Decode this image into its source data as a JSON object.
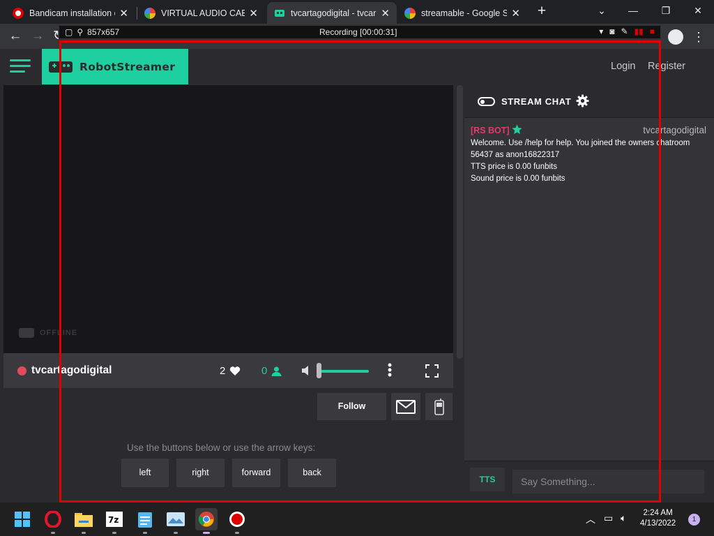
{
  "browser": {
    "tabs": [
      {
        "title": "Bandicam installation c",
        "favicon": "bandicam-icon"
      },
      {
        "title": "VIRTUAL AUDIO CABLE",
        "favicon": "google-icon"
      },
      {
        "title": "tvcartagodigital - tvcar",
        "favicon": "robotstreamer-icon"
      },
      {
        "title": "streamable - Google Se",
        "favicon": "google-icon"
      }
    ],
    "active_tab": 2,
    "new_tab_label": "+"
  },
  "recorder": {
    "size": "857x657",
    "status": "Recording [00:00:31]"
  },
  "site": {
    "brand": "RobotStreamer",
    "nav": {
      "login": "Login",
      "register": "Register"
    },
    "accent": "#1ed0a0"
  },
  "player": {
    "offline_label": "OFFLINE",
    "streamer": "tvcartagodigital",
    "likes": "2",
    "viewers": "0",
    "follow_label": "Follow"
  },
  "controls": {
    "hint": "Use the buttons below or use the arrow keys:",
    "buttons": [
      "left",
      "right",
      "forward",
      "back"
    ]
  },
  "chat": {
    "title": "STREAM CHAT",
    "messages": [
      {
        "sender": "[RS BOT]",
        "channel": "tvcartagodigital",
        "lines": [
          "Welcome. Use /help for help. You joined the owners chatroom 56437 as anon16822317",
          "TTS price is 0.00 funbits",
          "Sound price is 0.00 funbits"
        ]
      }
    ],
    "tts_label": "TTS",
    "input_placeholder": "Say Something..."
  },
  "taskbar": {
    "apps": [
      "windows-start-icon",
      "opera-icon",
      "file-explorer-icon",
      "7zip-icon",
      "notepad-icon",
      "photos-icon",
      "chrome-icon",
      "bandicam-icon"
    ],
    "time": "2:24 AM",
    "date": "4/13/2022",
    "notifications": "1"
  }
}
